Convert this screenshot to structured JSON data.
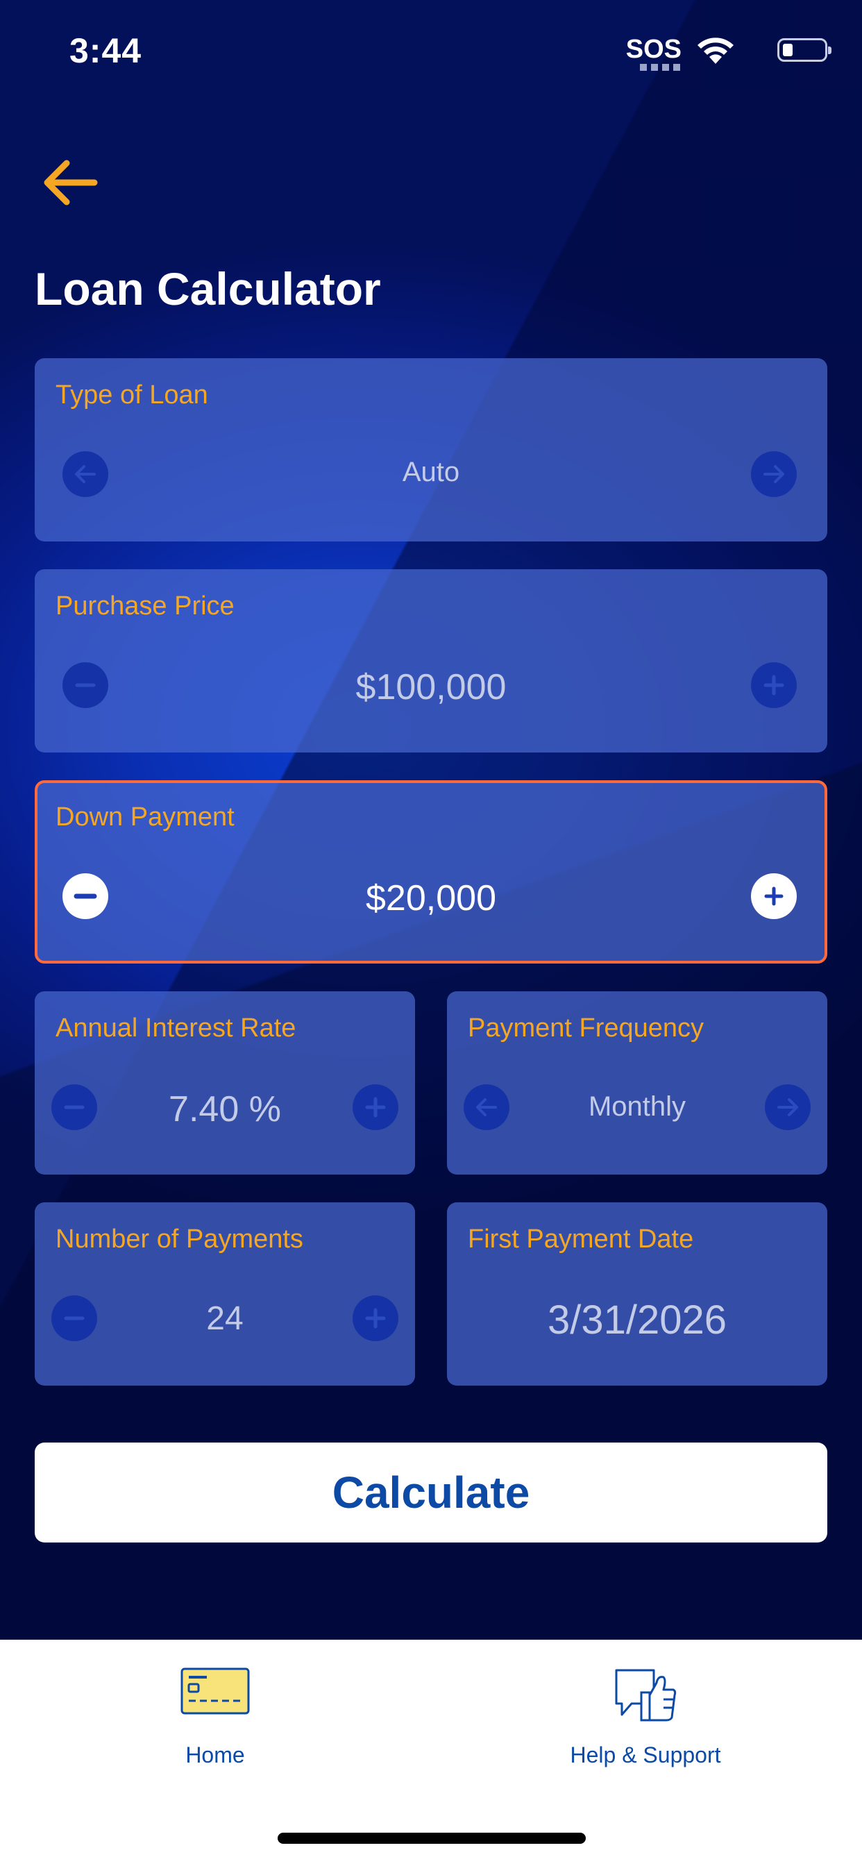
{
  "status_bar": {
    "time": "3:44",
    "sos": "SOS"
  },
  "header": {
    "back_icon": "arrow-left-icon",
    "title": "Loan Calculator"
  },
  "colors": {
    "accent": "#f5a623",
    "active_border": "#ff6a3d",
    "card_bg": "#4868ce",
    "button_text": "#0c4aa6"
  },
  "fields": {
    "loan_type": {
      "label": "Type of Loan",
      "value": "Auto"
    },
    "purchase_price": {
      "label": "Purchase Price",
      "value": "$100,000"
    },
    "down_payment": {
      "label": "Down Payment",
      "value": "$20,000"
    },
    "interest_rate": {
      "label": "Annual Interest Rate",
      "value": "7.40 %"
    },
    "payment_frequency": {
      "label": "Payment Frequency",
      "value": "Monthly"
    },
    "num_payments": {
      "label": "Number of Payments",
      "value": "24"
    },
    "first_payment_date": {
      "label": "First Payment Date",
      "value": "3/31/2026"
    }
  },
  "calculate_label": "Calculate",
  "tabbar": {
    "items": [
      {
        "label": "Home",
        "icon": "credit-card-icon"
      },
      {
        "label": "Help & Support",
        "icon": "thumbs-up-chat-icon"
      }
    ]
  }
}
